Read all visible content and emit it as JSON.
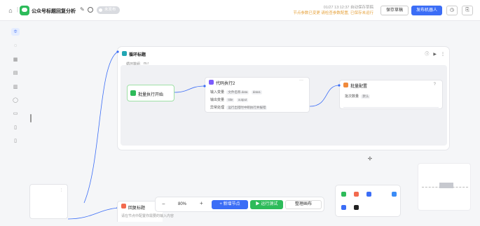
{
  "header": {
    "app_title": "公众号标题回复分析",
    "status_badge": "未发布",
    "save_info": "01/27 13:12:37 自动保存草稿",
    "save_warning": "节点参数已变更 请检查参数配置, 已保存未运行",
    "save_button": "保存草稿",
    "publish_button": "发布机器人",
    "history_icon": "clock-icon",
    "more_button": "copy-icon"
  },
  "left_toolbar": {
    "items": [
      "filter-icon",
      "chat-icon",
      "image-icon",
      "book-icon",
      "table-icon",
      "bubble-icon",
      "message-icon",
      "doc-icon",
      "file-icon"
    ]
  },
  "loop_node": {
    "title": "循环标题",
    "sub_label": "循环数组",
    "sub_value": "m.r"
  },
  "start_node": {
    "title": "批量执行开始"
  },
  "code_node": {
    "title": "代码执行2",
    "more": "···",
    "rows": [
      {
        "key": "输入变量",
        "tags": [
          "文件名称.data",
          "data1"
        ]
      },
      {
        "key": "输出变量",
        "tags": [
          "title",
          "output"
        ]
      },
      {
        "key": "异常处理",
        "tags": [
          "运行出错时中断执行并报错"
        ]
      }
    ]
  },
  "batch_node": {
    "title": "批量配置",
    "more": "?",
    "row_key": "批次数量",
    "row_val": "默认"
  },
  "bottom_node": {
    "title": "回复标题",
    "desc": "请在节点中配置你需要的输入内容"
  },
  "bottom_toolbar": {
    "zoom": "80%",
    "zoom_minus": "−",
    "zoom_plus": "+",
    "add_node": "+ 新增节点",
    "run_test": "▶ 运行测试",
    "arrange": "整理画布"
  },
  "colors": {
    "accent": "#3b6df6",
    "success": "#2dbb5a",
    "code": "#7c5cfc",
    "batch": "#f08a3c",
    "warning": "#e6a23c"
  }
}
